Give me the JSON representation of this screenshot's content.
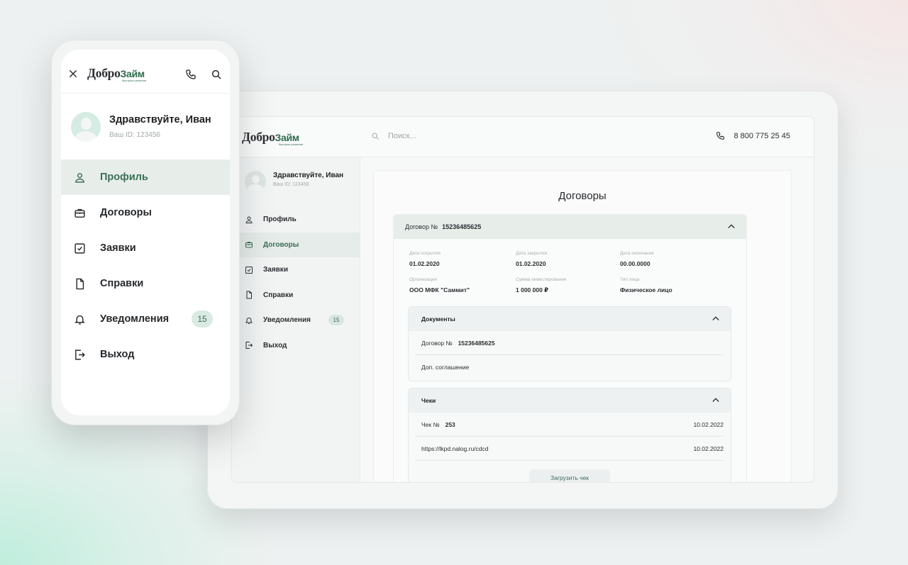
{
  "brand": {
    "logo_first": "Добро",
    "logo_second": "Займ",
    "tagline": "быстрые решения",
    "accent": "#3c6e56"
  },
  "tablet": {
    "search": {
      "placeholder": "Поиск..."
    },
    "phone_number": "8 800 775 25 45",
    "user": {
      "greeting": "Здравствуйте, Иван",
      "id_label": "Ваш ID: 123456"
    },
    "nav": [
      {
        "label": "Профиль",
        "icon": "user-icon"
      },
      {
        "label": "Договоры",
        "icon": "briefcase-icon",
        "active": true
      },
      {
        "label": "Заявки",
        "icon": "checkbox-icon"
      },
      {
        "label": "Справки",
        "icon": "document-icon"
      },
      {
        "label": "Уведомления",
        "icon": "bell-icon",
        "badge": "15"
      },
      {
        "label": "Выход",
        "icon": "logout-icon"
      }
    ],
    "page_title": "Договоры",
    "contract": {
      "label": "Договор №",
      "number": "15236485625",
      "fields": [
        {
          "label": "Дата открытия",
          "value": "01.02.2020"
        },
        {
          "label": "Дата закрытия",
          "value": "01.02.2020"
        },
        {
          "label": "Дата окончания",
          "value": "00.00.0000"
        },
        {
          "label": "Организация",
          "value": "ООО МФК \"Саммит\""
        },
        {
          "label": "Сумма инвестирования",
          "value": "1 000 000 ₽"
        },
        {
          "label": "Тип лица",
          "value": "Физическое лицо"
        }
      ],
      "documents": {
        "title": "Документы",
        "rows": [
          {
            "label": "Договор №",
            "number": "15236485625"
          },
          {
            "label": "Доп. соглашение"
          }
        ]
      },
      "receipts": {
        "title": "Чеки",
        "rows": [
          {
            "label": "Чек №",
            "number": "253",
            "date": "10.02.2022"
          },
          {
            "label": "https://lkpd.nalog.ru/cdcd",
            "date": "10.02.2022"
          }
        ],
        "upload_label": "Загрузить чек"
      }
    }
  },
  "phone": {
    "user": {
      "greeting": "Здравствуйте, Иван",
      "id_label": "Ваш ID: 123456"
    },
    "nav": [
      {
        "label": "Профиль",
        "icon": "user-icon",
        "active": true
      },
      {
        "label": "Договоры",
        "icon": "briefcase-icon"
      },
      {
        "label": "Заявки",
        "icon": "checkbox-icon"
      },
      {
        "label": "Справки",
        "icon": "document-icon"
      },
      {
        "label": "Уведомления",
        "icon": "bell-icon",
        "badge": "15"
      },
      {
        "label": "Выход",
        "icon": "logout-icon"
      }
    ]
  }
}
